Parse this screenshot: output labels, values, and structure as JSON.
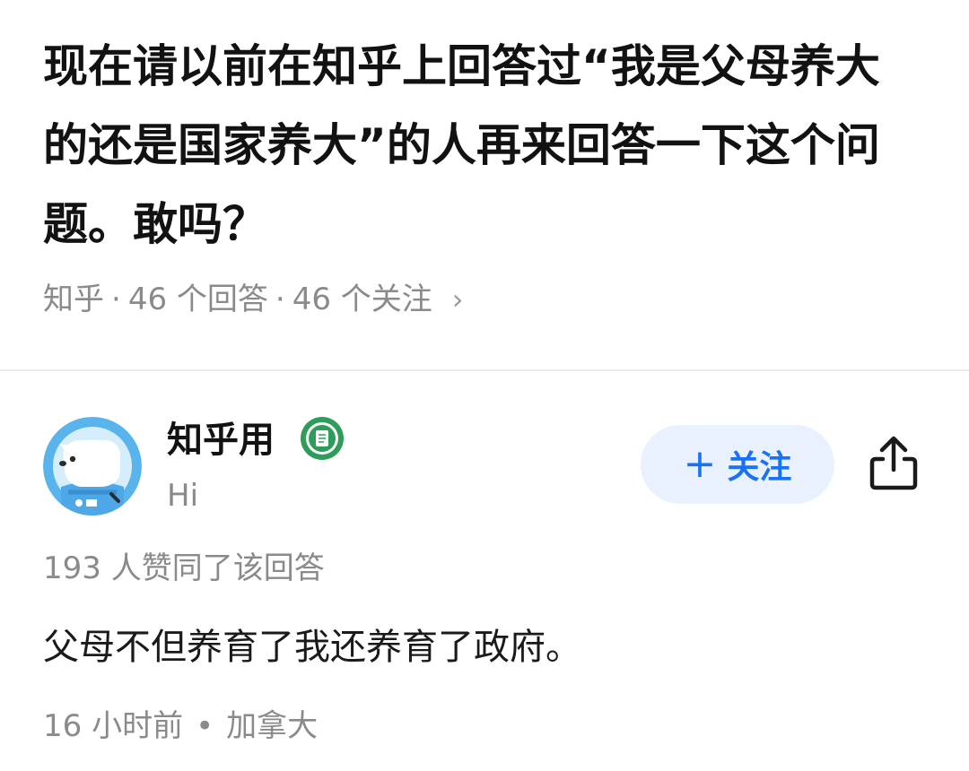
{
  "question": {
    "title": "现在请以前在知乎上回答过“我是父母养大的还是国家养大”的人再来回答一下这个问题。敢吗？",
    "source": "知乎",
    "answer_count": "46 个回答",
    "follower_count": "46 个关注",
    "separator": "·",
    "chevron": "›"
  },
  "answer": {
    "author": {
      "name": "知乎用",
      "bio": "Hi",
      "badge_icon": "green-badge-icon",
      "avatar_icon": "mascot-avatar"
    },
    "follow_button": {
      "plus": "+",
      "label": "关注"
    },
    "share_icon": "share-icon",
    "vote_text": "193 人赞同了该回答",
    "content": "父母不但养育了我还养育了政府。",
    "time": "16 小时前",
    "dot": "•",
    "location": "加拿大"
  },
  "colors": {
    "accent": "#1772f6",
    "follow_bg": "#e8f1fd",
    "meta_text": "#8a8a8a",
    "badge_green": "#2e9d5a"
  }
}
